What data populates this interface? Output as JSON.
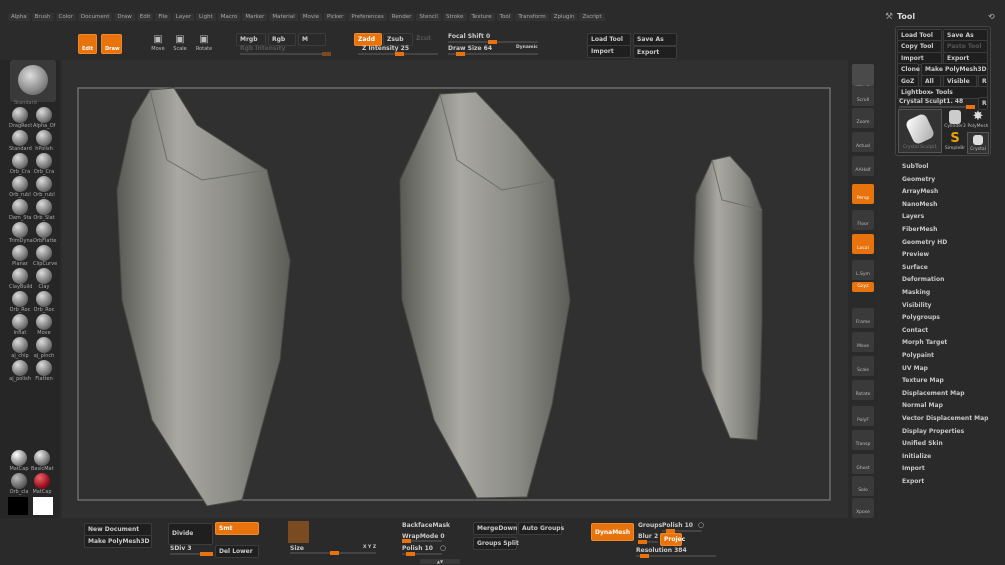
{
  "menu": [
    "Alpha",
    "Brush",
    "Color",
    "Document",
    "Draw",
    "Edit",
    "File",
    "Layer",
    "Light",
    "Macro",
    "Marker",
    "Material",
    "Movie",
    "Picker",
    "Preferences",
    "Render",
    "Stencil",
    "Stroke",
    "Texture",
    "Tool",
    "Transform",
    "Zplugin",
    "Zscript"
  ],
  "toolbar": {
    "edit": "Edit",
    "draw": "Draw",
    "move": "Move",
    "scale": "Scale",
    "rotate": "Rotate",
    "mrgb": "Mrgb",
    "rgb": "Rgb",
    "m": "M",
    "rgb_intensity": "Rgb Intensity",
    "zadd": "Zadd",
    "zsub": "Zsub",
    "zcut": "Zcut",
    "z_intensity": "Z Intensity 25",
    "focal_shift": "Focal Shift 0",
    "draw_size": "Draw Size 64",
    "dynamic": "Dynamic",
    "load_tool": "Load Tool",
    "save_as": "Save As",
    "import": "Import",
    "export": "Export"
  },
  "left": {
    "current_brush": "Standard",
    "brushes": [
      "DragRect",
      "Alpha_Of",
      "Standard",
      "hPolish",
      "Orb_Cra",
      "Orb_Cra",
      "Orb_rubl",
      "Orb_rubl",
      "Dam_Sta",
      "Orb_Slat",
      "TrimDyna",
      "OrbFlatte",
      "Planar",
      "ClipCurve",
      "ClayBuild",
      "Clay",
      "Orb_Roc",
      "Orb_Roc",
      "Inflat",
      "Move",
      "aj_chip",
      "aj_pinch",
      "aj_polish",
      "Flatten"
    ],
    "materials": [
      "MatCap",
      "BasicMat",
      "Orb_cla",
      "MatCap"
    ]
  },
  "shelf": [
    "SPix 3",
    "Scroll",
    "Zoom",
    "Actual",
    "AAHalf",
    "Persp",
    "Floor",
    "Local",
    "L.Sym",
    "Gxyz",
    "Frame",
    "Move",
    "Scale",
    "Rotate",
    "PolyF",
    "Transp",
    "Ghost",
    "Solo",
    "Xpose"
  ],
  "tool": {
    "title": "Tool",
    "load_tool": "Load Tool",
    "save_as": "Save As",
    "copy_tool": "Copy Tool",
    "paste_tool": "Paste Tool",
    "import": "Import",
    "export": "Export",
    "clone": "Clone",
    "make_polymesh": "Make PolyMesh3D",
    "goz": "GoZ",
    "all": "All",
    "visible": "Visible",
    "r": "R",
    "lightbox": "Lightbox▸ Tools",
    "current": "Crystal Sculpt1. 48",
    "thumbs": [
      "Crystal Sculpt1",
      "Cylinder3",
      "PolyMesh",
      "SimpleBr",
      "Crystal"
    ],
    "sections": [
      "SubTool",
      "Geometry",
      "ArrayMesh",
      "NanoMesh",
      "Layers",
      "FiberMesh",
      "Geometry HD",
      "Preview",
      "Surface",
      "Deformation",
      "Masking",
      "Visibility",
      "Polygroups",
      "Contact",
      "Morph Target",
      "Polypaint",
      "UV Map",
      "Texture Map",
      "Displacement Map",
      "Normal Map",
      "Vector Displacement Map",
      "Display Properties",
      "Unified Skin",
      "Initialize",
      "Import",
      "Export"
    ]
  },
  "bottom": {
    "new_document": "New Document",
    "make_polymesh": "Make PolyMesh3D",
    "divide": "Divide",
    "smt": "Smt",
    "sdiv": "SDiv 3",
    "del_lower": "Del Lower",
    "size": "Size",
    "xyz": "X Y Z",
    "backface": "BackfaceMask",
    "wrapmode": "WrapMode 0",
    "polish": "Polish 10",
    "mergedown": "MergeDown",
    "auto_groups": "Auto Groups",
    "groups_split": "Groups Split",
    "dynamesh": "DynaMesh",
    "groups": "Groups",
    "polish2": "Polish 10",
    "blur": "Blur 2",
    "project": "Projec",
    "resolution": "Resolution 384"
  },
  "colors": {
    "accent": "#e8730c"
  }
}
